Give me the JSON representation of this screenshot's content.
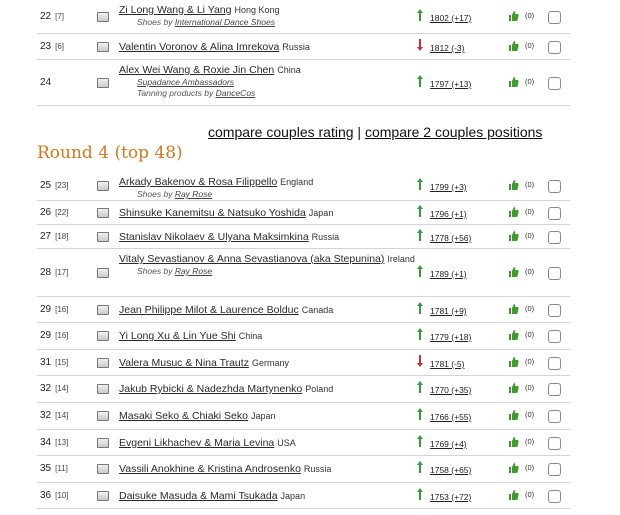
{
  "compare": {
    "rating_link": "compare couples rating",
    "separator": "|",
    "positions_link": "compare 2 couples positions"
  },
  "round": {
    "title": "Round 4 (top 48)"
  },
  "colors": {
    "up": "#3a9a3a",
    "down": "#c83232",
    "accent": "#cc7a1c"
  },
  "top_rows": [
    {
      "rank": "22",
      "prev": "[7]",
      "couple": "Zi Long Wang & Li Yang",
      "country": "Hong Kong",
      "sub": [
        {
          "prefix": "Shoes by ",
          "link": "International Dance Shoes"
        }
      ],
      "dir": "up",
      "rating": "1802 (+17)",
      "likes": "(0)"
    },
    {
      "rank": "23",
      "prev": "[6]",
      "couple": "Valentin Voronov & Alina Imrekova",
      "country": "Russia",
      "sub": [],
      "dir": "down",
      "rating": "1812 (-3)",
      "likes": "(0)"
    },
    {
      "rank": "24",
      "prev": "",
      "couple": "Alex Wei Wang & Roxie Jin Chen",
      "country": "China",
      "sub": [
        {
          "prefix": "",
          "link": "Supadance Ambassadors"
        },
        {
          "prefix": "Tanning products by ",
          "link": "DanceCos"
        }
      ],
      "dir": "up",
      "rating": "1797 (+13)",
      "likes": "(0)"
    }
  ],
  "rows": [
    {
      "rank": "25",
      "prev": "[23]",
      "couple": "Arkady Bakenov & Rosa Filippello",
      "country": "England",
      "sub": [
        {
          "prefix": "Shoes by ",
          "link": "Ray Rose"
        }
      ],
      "dir": "up",
      "rating": "1799 (+3)",
      "likes": "(0)"
    },
    {
      "rank": "26",
      "prev": "[22]",
      "couple": "Shinsuke Kanemitsu & Natsuko Yoshida",
      "country": "Japan",
      "sub": [],
      "dir": "up",
      "rating": "1796 (+1)",
      "likes": "(0)"
    },
    {
      "rank": "27",
      "prev": "[18]",
      "couple": "Stanislav Nikolaev & Ulyana Maksimkina",
      "country": "Russia",
      "sub": [],
      "dir": "up",
      "rating": "1778 (+56)",
      "likes": "(0)"
    },
    {
      "rank": "28",
      "prev": "[17]",
      "couple": "Vitaly Sevastianov & Anna Sevastianova (aka Stepunina)",
      "country": "Ireland",
      "sub": [
        {
          "prefix": "Shoes by ",
          "link": "Ray Rose"
        }
      ],
      "dir": "up",
      "rating": "1789 (+1)",
      "likes": "(0)"
    },
    {
      "rank": "29",
      "prev": "[16]",
      "couple": "Jean Philippe Milot & Laurence Bolduc",
      "country": "Canada",
      "sub": [],
      "dir": "up",
      "rating": "1781 (+9)",
      "likes": "(0)"
    },
    {
      "rank": "29",
      "prev": "[16]",
      "couple": "Yi Long Xu & Lin Yue Shi",
      "country": "China",
      "sub": [],
      "dir": "up",
      "rating": "1779 (+18)",
      "likes": "(0)"
    },
    {
      "rank": "31",
      "prev": "[15]",
      "couple": "Valera Musuc & Nina Trautz",
      "country": "Germany",
      "sub": [],
      "dir": "down",
      "rating": "1781 (-5)",
      "likes": "(0)"
    },
    {
      "rank": "32",
      "prev": "[14]",
      "couple": "Jakub Rybicki & Nadezhda Martynenko",
      "country": "Poland",
      "sub": [],
      "dir": "up",
      "rating": "1770 (+35)",
      "likes": "(0)"
    },
    {
      "rank": "32",
      "prev": "[14]",
      "couple": "Masaki Seko & Chiaki Seko",
      "country": "Japan",
      "sub": [],
      "dir": "up",
      "rating": "1766 (+55)",
      "likes": "(0)"
    },
    {
      "rank": "34",
      "prev": "[13]",
      "couple": "Evgeni Likhachev & Maria Levina",
      "country": "USA",
      "sub": [],
      "dir": "up",
      "rating": "1769 (+4)",
      "likes": "(0)"
    },
    {
      "rank": "35",
      "prev": "[11]",
      "couple": "Vassili Anokhine & Kristina Androsenko",
      "country": "Russia",
      "sub": [],
      "dir": "up",
      "rating": "1758 (+65)",
      "likes": "(0)"
    },
    {
      "rank": "36",
      "prev": "[10]",
      "couple": "Daisuke Masuda & Mami Tsukada",
      "country": "Japan",
      "sub": [],
      "dir": "up",
      "rating": "1753 (+72)",
      "likes": "(0)"
    }
  ]
}
